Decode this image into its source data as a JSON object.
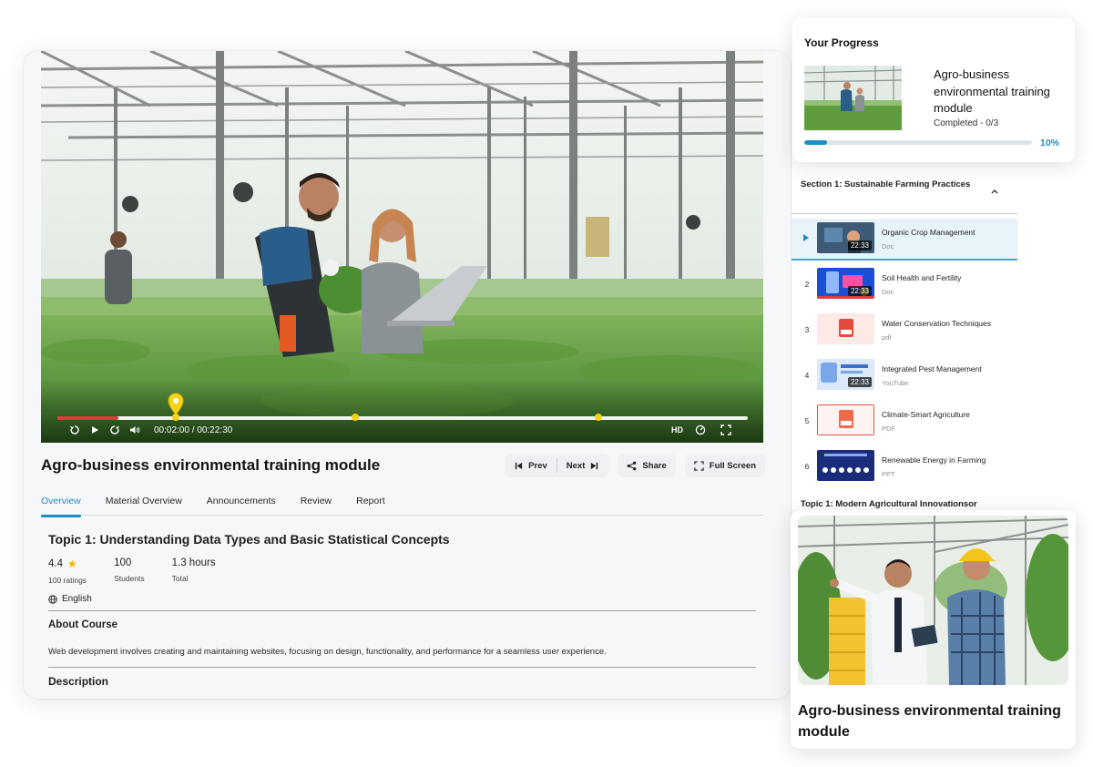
{
  "video": {
    "time_display": "00:02:00 / 00:22:30",
    "quality_label": "HD",
    "progress_fraction": 0.089,
    "marker_positions": [
      0.172,
      0.432,
      0.784
    ]
  },
  "course": {
    "title": "Agro-business environmental training module"
  },
  "actions": {
    "prev": "Prev",
    "next": "Next",
    "share": "Share",
    "fullscreen": "Full Screen"
  },
  "tabs": [
    {
      "label": "Overview",
      "active": true
    },
    {
      "label": "Material Overview",
      "active": false
    },
    {
      "label": "Announcements",
      "active": false
    },
    {
      "label": "Review",
      "active": false
    },
    {
      "label": "Report",
      "active": false
    }
  ],
  "overview": {
    "topic_title": "Topic 1: Understanding Data Types and Basic Statistical Concepts",
    "rating": "4.4",
    "rating_label": "100 ratings",
    "students": "100",
    "students_label": "Students",
    "hours": "1.3 hours",
    "hours_label": "Total",
    "language": "English",
    "about_title": "About Course",
    "about_text": "Web development involves creating and maintaining websites, focusing on design, functionality, and performance for a seamless user experience.",
    "description_title": "Description"
  },
  "progress": {
    "title": "Your Progress",
    "course": "Agro-business environmental training module",
    "status": "Completed - 0/3",
    "percent_label": "10%",
    "fraction": 0.1
  },
  "sidebar": {
    "section_title": "Section 1: Sustainable Farming Practices",
    "lessons": [
      {
        "num": "",
        "title": "Organic Crop Management",
        "type": "Doc",
        "duration": "22:33",
        "active": true,
        "thumb": "video"
      },
      {
        "num": "2",
        "title": "Soil Health and Fertility",
        "type": "Doc",
        "duration": "22:33",
        "active": false,
        "thumb": "video-blue"
      },
      {
        "num": "3",
        "title": "Water Conservation Techniques",
        "type": "pdf",
        "duration": "",
        "active": false,
        "thumb": "pdf"
      },
      {
        "num": "4",
        "title": "Integrated Pest Management",
        "type": "YouTube",
        "duration": "22:33",
        "active": false,
        "thumb": "video-light"
      },
      {
        "num": "5",
        "title": "Climate-Smart Agriculture",
        "type": "PDF",
        "duration": "",
        "active": false,
        "thumb": "pdf-framed"
      },
      {
        "num": "6",
        "title": "Renewable Energy in Farming",
        "type": "PPT",
        "duration": "",
        "active": false,
        "thumb": "ppt"
      }
    ],
    "next_topic": "Topic 1: Modern Agricultural Innovationsor"
  },
  "feature": {
    "title": "Agro-business environmental training module"
  },
  "colors": {
    "accent": "#1a8ec6",
    "scrub_red": "#e23a3a",
    "marker_yellow": "#f7d417",
    "star": "#f6b400"
  }
}
